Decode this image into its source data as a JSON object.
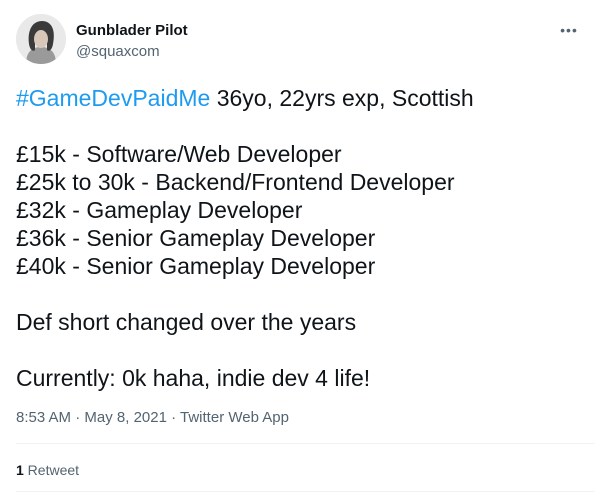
{
  "author": {
    "name": "Gunblader Pilot",
    "handle": "@squaxcom",
    "avatar_icon": "person-avatar-icon"
  },
  "more_icon": "more-options-icon",
  "tweet": {
    "hashtag": "#GameDevPaidMe",
    "intro": " 36yo, 22yrs exp, Scottish",
    "lines": [
      "£15k - Software/Web Developer",
      "£25k to 30k - Backend/Frontend Developer",
      "£32k - Gameplay Developer",
      "£36k - Senior Gameplay Developer",
      "£40k - Senior Gameplay Developer"
    ],
    "comment": "Def short changed over the years",
    "currently": "Currently: 0k haha, indie dev 4 life!"
  },
  "meta": {
    "time": "8:53 AM",
    "date": "May 8, 2021",
    "source": "Twitter Web App",
    "separator": " · "
  },
  "stats": {
    "retweet_count": "1",
    "retweet_label": " Retweet"
  },
  "colors": {
    "hashtag": "#1d9bf0",
    "secondary_text": "#536471",
    "primary_text": "#0f1419"
  }
}
